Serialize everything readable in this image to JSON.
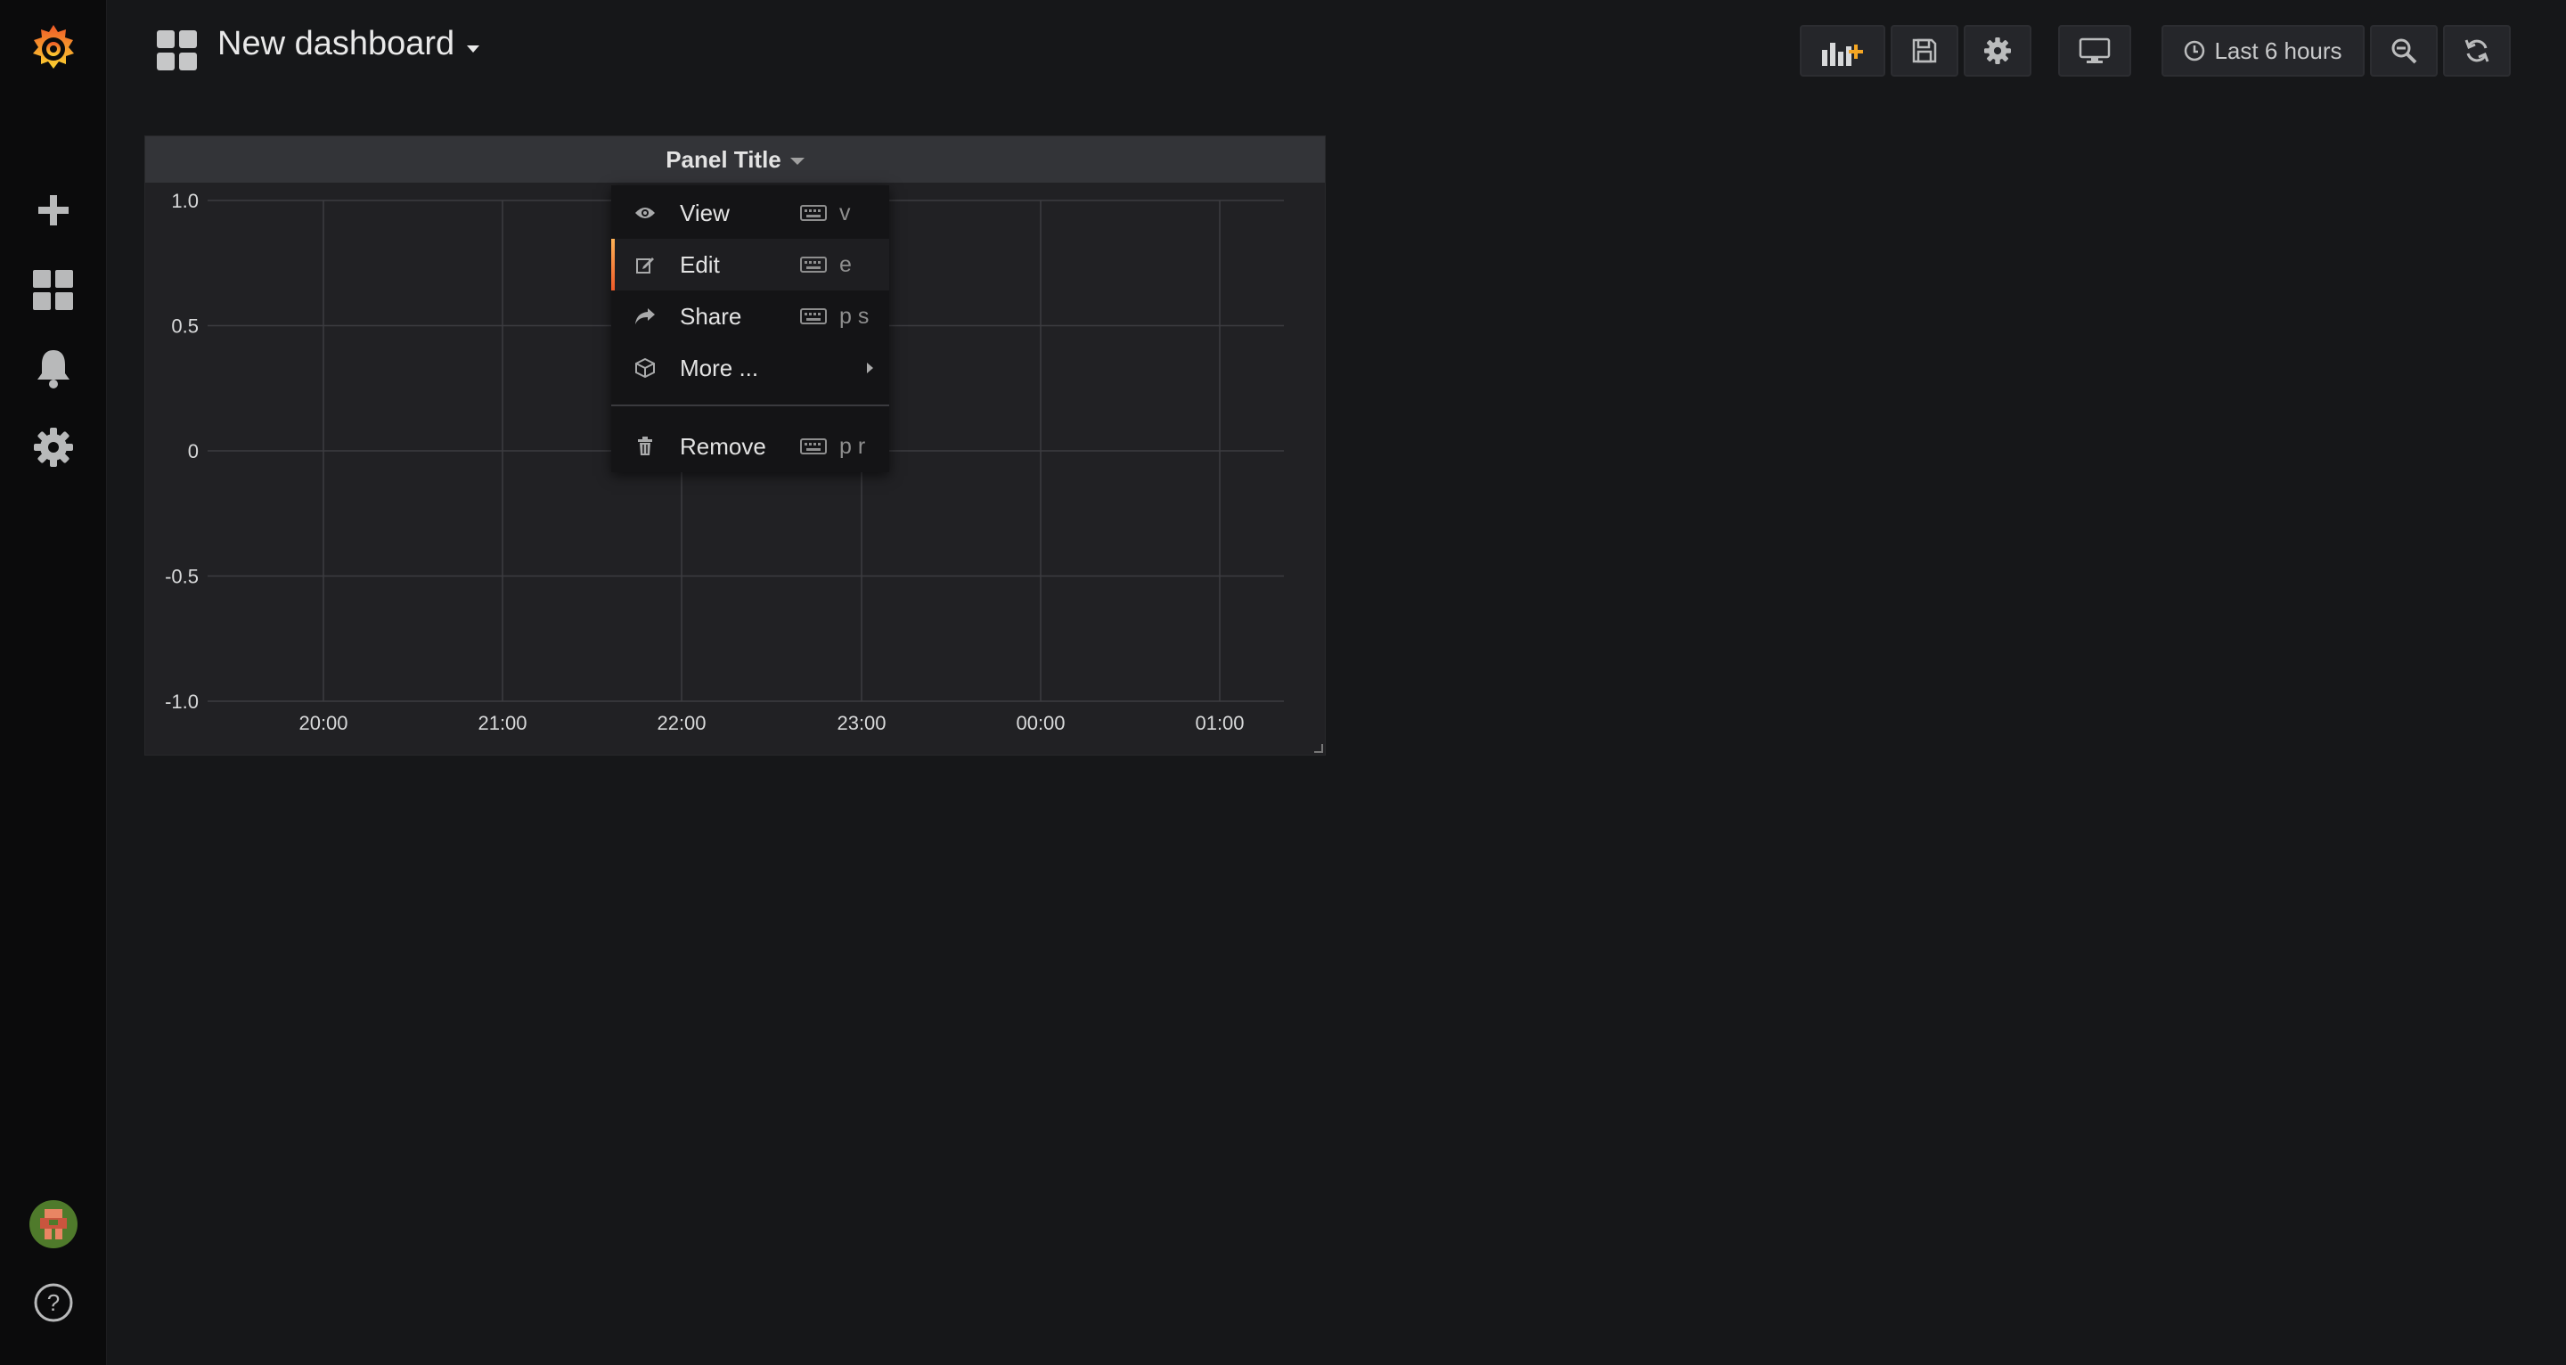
{
  "dashboard": {
    "title": "New dashboard"
  },
  "toolbar": {
    "add_panel": "add-panel-icon",
    "save": "save-icon",
    "settings": "gear-icon",
    "cycle_view": "monitor-icon",
    "time_range_label": "Last 6 hours",
    "zoom_out": "zoom-out-icon",
    "refresh": "refresh-icon"
  },
  "sidebar": {
    "items": [
      {
        "icon": "grafana-logo"
      },
      {
        "icon": "plus-icon"
      },
      {
        "icon": "dashboards-icon"
      },
      {
        "icon": "bell-icon"
      },
      {
        "icon": "gear-icon"
      },
      {
        "icon": "avatar"
      },
      {
        "icon": "help-icon"
      }
    ],
    "help_label": "?"
  },
  "panel": {
    "title": "Panel Title"
  },
  "menu": {
    "items": [
      {
        "label": "View",
        "shortcut": "v",
        "icon": "eye-icon"
      },
      {
        "label": "Edit",
        "shortcut": "e",
        "icon": "edit-icon",
        "active": true
      },
      {
        "label": "Share",
        "shortcut": "p s",
        "icon": "share-icon"
      },
      {
        "label": "More ...",
        "shortcut": "",
        "icon": "cube-icon",
        "submenu": true
      },
      {
        "label": "Remove",
        "shortcut": "p r",
        "icon": "trash-icon"
      }
    ]
  },
  "colors": {
    "background": "#161719",
    "panel": "#212124",
    "panel_header": "#333438",
    "accent": "#f05a28"
  },
  "chart_data": {
    "type": "line",
    "title": "Panel Title",
    "x": [
      "20:00",
      "21:00",
      "22:00",
      "23:00",
      "00:00",
      "01:00"
    ],
    "series": [],
    "y_ticks": [
      "1.0",
      "0.5",
      "0",
      "-0.5",
      "-1.0"
    ],
    "ylim": [
      -1.0,
      1.0
    ],
    "grid": true
  }
}
